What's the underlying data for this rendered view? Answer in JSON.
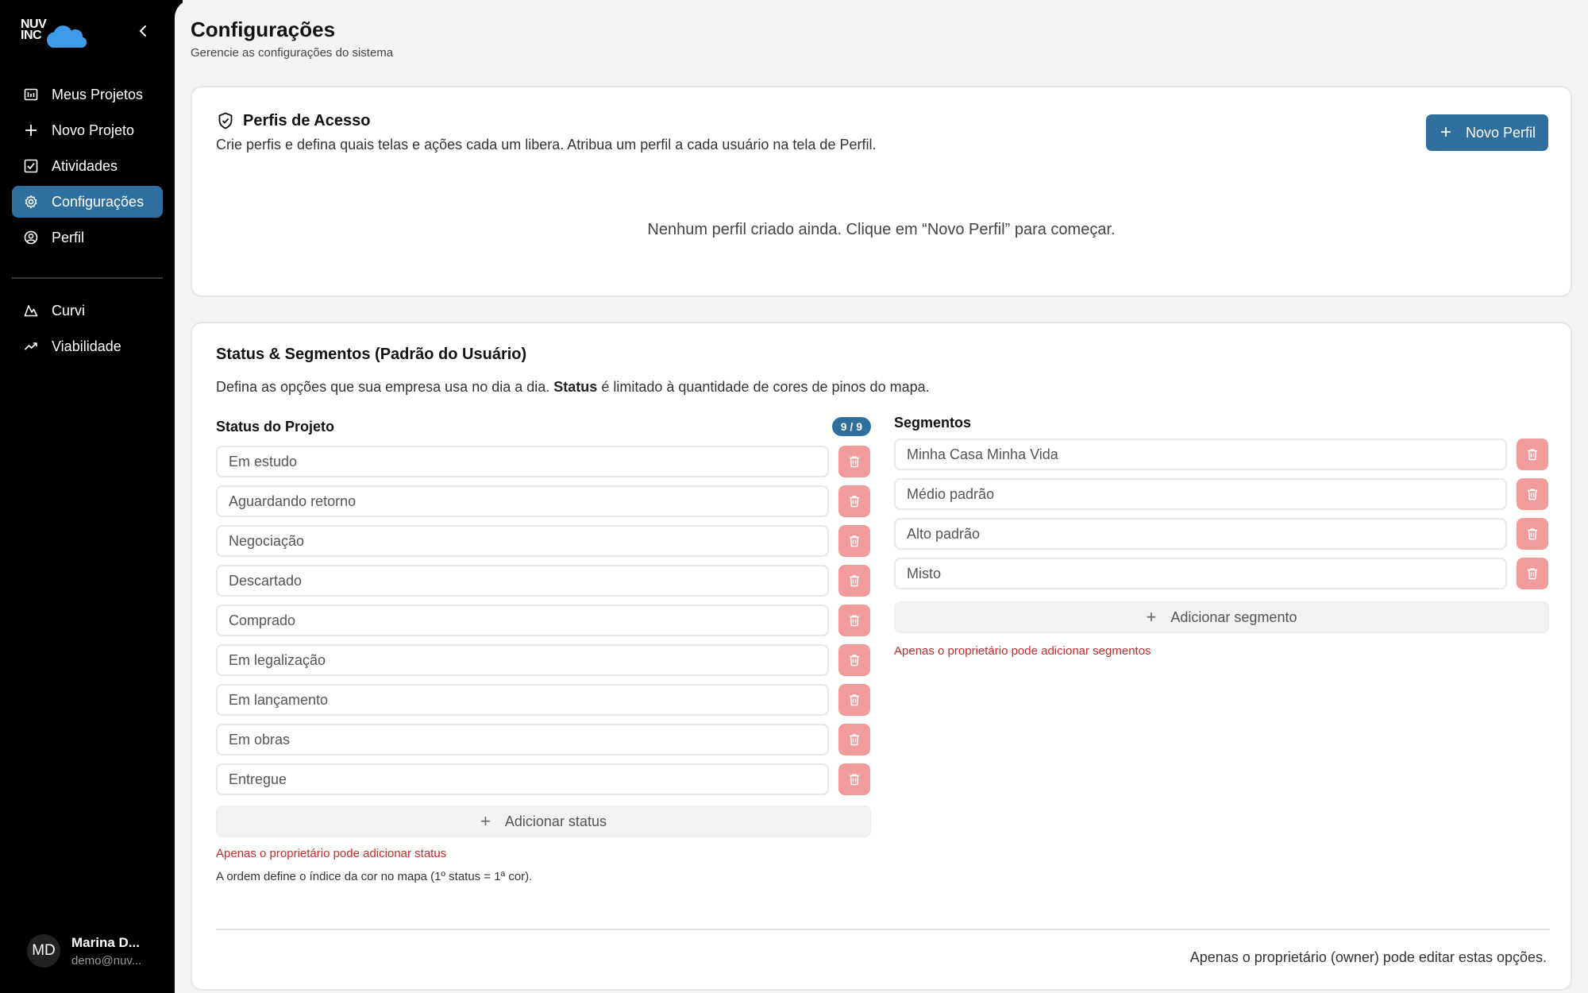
{
  "brand": {
    "logo_line1": "NUV",
    "logo_line2": "INC",
    "accent": "#2f6f9e",
    "danger": "#c62a2a"
  },
  "sidebar": {
    "items": [
      {
        "label": "Meus Projetos",
        "icon": "projects-icon"
      },
      {
        "label": "Novo Projeto",
        "icon": "plus-icon"
      },
      {
        "label": "Atividades",
        "icon": "checkbox-icon"
      },
      {
        "label": "Configurações",
        "icon": "gear-icon",
        "active": true
      },
      {
        "label": "Perfil",
        "icon": "user-circle-icon"
      }
    ],
    "tools": [
      {
        "label": "Curvi",
        "icon": "mountain-icon"
      },
      {
        "label": "Viabilidade",
        "icon": "trend-up-icon"
      }
    ]
  },
  "user": {
    "initials": "MD",
    "name": "Marina D...",
    "email": "demo@nuv..."
  },
  "header": {
    "title": "Configurações",
    "subtitle": "Gerencie as configurações do sistema"
  },
  "profiles": {
    "title": "Perfis de Acesso",
    "description": "Crie perfis e defina quais telas e ações cada um libera. Atribua um perfil a cada usuário na tela de Perfil.",
    "new_button": "Novo Perfil",
    "empty": "Nenhum perfil criado ainda. Clique em “Novo Perfil” para começar."
  },
  "status_segments": {
    "title": "Status & Segmentos (Padrão do Usuário)",
    "description_pre": "Defina as opções que sua empresa usa no dia a dia.",
    "description_bold": "Status",
    "description_post": "é limitado à quantidade de cores de pinos do mapa.",
    "status": {
      "heading": "Status do Projeto",
      "badge": "9 / 9",
      "items": [
        "Em estudo",
        "Aguardando retorno",
        "Negociação",
        "Descartado",
        "Comprado",
        "Em legalização",
        "Em lançamento",
        "Em obras",
        "Entregue"
      ],
      "add_label": "Adicionar status",
      "warning": "Apenas o proprietário pode adicionar status",
      "note": "A ordem define o índice da cor no mapa (1º status = 1ª cor)."
    },
    "segments": {
      "heading": "Segmentos",
      "items": [
        "Minha Casa Minha Vida",
        "Médio padrão",
        "Alto padrão",
        "Misto"
      ],
      "add_label": "Adicionar segmento",
      "warning": "Apenas o proprietário pode adicionar segmentos"
    },
    "footer": "Apenas o proprietário (owner) pode editar estas opções."
  }
}
